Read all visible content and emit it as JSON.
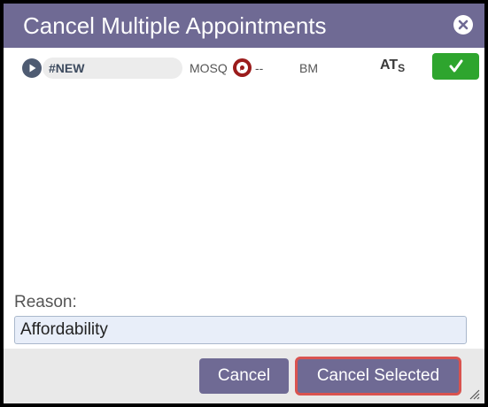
{
  "dialog": {
    "title": "Cancel Multiple Appointments",
    "close_icon": "close-icon"
  },
  "appointments": [
    {
      "name": "#NEW",
      "location": "MOSQ",
      "status_icon": "chat-bubble-icon",
      "status_text": "--",
      "initials": "BM",
      "code_main": "AT",
      "code_sub": "S",
      "selected": true
    }
  ],
  "reason": {
    "label": "Reason:",
    "value": "Affordability"
  },
  "footer": {
    "cancel_label": "Cancel",
    "cancel_selected_label": "Cancel Selected"
  },
  "colors": {
    "titlebar": "#6f6a94",
    "button": "#6f6a94",
    "check": "#2ea52e",
    "highlight": "#d9534f",
    "status_icon": "#9b1c1c"
  }
}
